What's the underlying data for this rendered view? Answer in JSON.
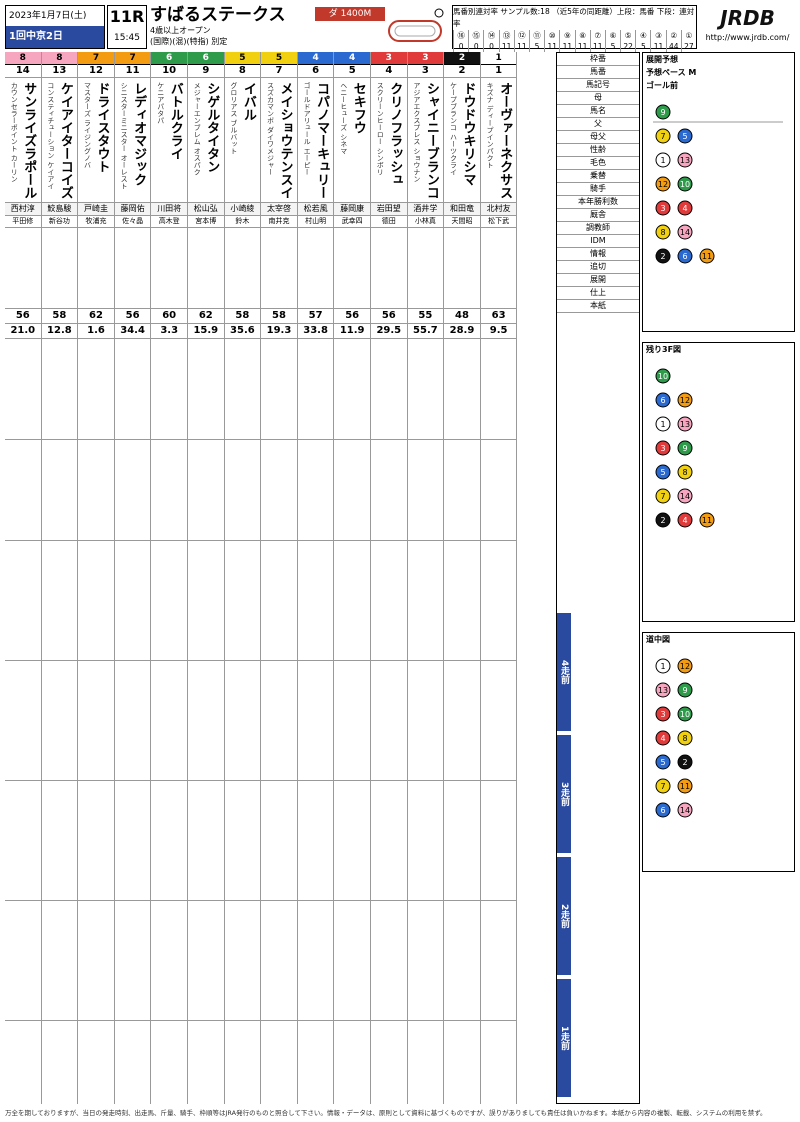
{
  "header": {
    "date": "2023年1月7日(土)",
    "meeting": "1回中京2日",
    "race_no": "11R",
    "post_time": "15:45",
    "race_name": "すばるステークス",
    "conditions": "4歳以上オープン",
    "conditions2": "(国際)(混)(特指) 別定",
    "distance": "ダ 1400M",
    "stats_title": "馬番別連対率 サンプル数:18 （近5年の同距離）上段：馬番 下段：連対率",
    "stats_nums": [
      "⑯",
      "⑮",
      "⑭",
      "⑬",
      "⑫",
      "⑪",
      "⑩",
      "⑨",
      "⑧",
      "⑦",
      "⑥",
      "⑤",
      "④",
      "③",
      "②",
      "①"
    ],
    "stats_rates": [
      "0",
      "0",
      "0",
      "11",
      "11",
      "5",
      "11",
      "11",
      "11",
      "11",
      "5",
      "22",
      "5",
      "11",
      "44",
      "27"
    ],
    "logo": "JRDB",
    "url": "http://www.jrdb.com/"
  },
  "horses": [
    {
      "waku": "8",
      "uma": "14",
      "name": "サンライズラポール",
      "sire": "カウンセラーポイント カーリン",
      "jockey": "西村淳",
      "trainer": "平田修",
      "stable_col": "#f39c12",
      "idm": "56",
      "idx": "21.0"
    },
    {
      "waku": "8",
      "uma": "13",
      "name": "ケイアイターコイズ",
      "sire": "コンスティチューション ケイアイ",
      "jockey": "鮫島駿",
      "trainer": "新谷功",
      "stable_col": "#f39c12",
      "idm": "58",
      "idx": "12.8"
    },
    {
      "waku": "7",
      "uma": "12",
      "name": "ドライスタウト",
      "sire": "マスターズ ライジングノバ",
      "jockey": "戸崎圭",
      "trainer": "牧浦充",
      "stable_col": "#2e9b4a",
      "idm": "62",
      "idx": "1.6"
    },
    {
      "waku": "7",
      "uma": "11",
      "name": "レディオマジック",
      "sire": "シニスターミニスター オーレスト",
      "jockey": "藤岡佑",
      "trainer": "佐々晶",
      "stable_col": "#2e9b4a",
      "idm": "56",
      "idx": "34.4"
    },
    {
      "waku": "6",
      "uma": "10",
      "name": "バトルクライ",
      "sire": "ケニアパタパ",
      "jockey": "川田将",
      "trainer": "高木登",
      "stable_col": "#2a4aa0",
      "idm": "60",
      "idx": "3.3"
    },
    {
      "waku": "6",
      "uma": "9",
      "name": "シゲルタイタン",
      "sire": "メジャーエンブレム オスパク",
      "jockey": "松山弘",
      "trainer": "宮本博",
      "stable_col": "#2a4aa0",
      "idm": "62",
      "idx": "15.9"
    },
    {
      "waku": "5",
      "uma": "8",
      "name": "イバル",
      "sire": "グロリアス ブルバット",
      "jockey": "小崎綾",
      "trainer": "鈴木",
      "stable_col": "#f1c40f",
      "idm": "58",
      "idx": "35.6"
    },
    {
      "waku": "5",
      "uma": "7",
      "name": "メイショウテンスイ",
      "sire": "スズカマンボ ダイワメジャー",
      "jockey": "太宰啓",
      "trainer": "南井克",
      "stable_col": "#f1c40f",
      "idm": "58",
      "idx": "19.3"
    },
    {
      "waku": "4",
      "uma": "6",
      "name": "コパノマーキュリー",
      "sire": "ゴールドアリュール エーピー",
      "jockey": "松若風",
      "trainer": "村山明",
      "stable_col": "#2980b9",
      "idm": "57",
      "idx": "33.8"
    },
    {
      "waku": "4",
      "uma": "5",
      "name": "セキフウ",
      "sire": "ヘニーヒューズ シネマ",
      "jockey": "藤岡康",
      "trainer": "武幸四",
      "stable_col": "#2980b9",
      "idm": "56",
      "idx": "11.9"
    },
    {
      "waku": "3",
      "uma": "4",
      "name": "クリノフラッシュ",
      "sire": "スクリーンヒーロー シンボリ",
      "jockey": "岩田望",
      "trainer": "德田",
      "stable_col": "#c0392b",
      "idm": "56",
      "idx": "29.5"
    },
    {
      "waku": "3",
      "uma": "3",
      "name": "シャイニーブランコ",
      "sire": "アジアエクスプレス ショウナン",
      "jockey": "酒井学",
      "trainer": "小林真",
      "stable_col": "#c0392b",
      "idm": "55",
      "idx": "55.7"
    },
    {
      "waku": "2",
      "uma": "2",
      "name": "ドウドウキリシマ",
      "sire": "ケープブランコ ハーツクライ",
      "jockey": "和田竜",
      "trainer": "天間昭",
      "stable_col": "#111111",
      "idm": "48",
      "idx": "28.9"
    },
    {
      "waku": "1",
      "uma": "1",
      "name": "オーヴァーネクサス",
      "sire": "キズナ ディープインパクト",
      "jockey": "北村友",
      "trainer": "松下武",
      "stable_col": "#ffffff",
      "idm": "63",
      "idx": "9.5"
    }
  ],
  "mid_labels": [
    "枠番",
    "馬番",
    "馬記号",
    "母",
    "馬名",
    "父",
    "母父",
    "性齢",
    "毛色",
    "乗替",
    "騎手",
    "本年勝利数",
    "厩舎",
    "調教師",
    "IDM",
    "情報",
    "追切",
    "展開",
    "仕上",
    "本紙"
  ],
  "sections": [
    "4走前",
    "3走前",
    "2走前",
    "1走前"
  ],
  "right": {
    "tenkai_title": "展開予想",
    "pace": "予想ペース M",
    "goal": "ゴール前",
    "agari_title": "残り3F図",
    "dochu_title": "道中図",
    "labels": [
      "外",
      "中",
      "内"
    ]
  },
  "footer": "万全を期しておりますが、当日の発走時刻、出走馬、斤量、騎手、枠順等はJRA発行のものと照合して下さい。情報・データは、原則として資料に基づくものですが、誤りがありましても責任は負いかねます。本紙から内容の複製、転載、システムの利用を禁ず。"
}
